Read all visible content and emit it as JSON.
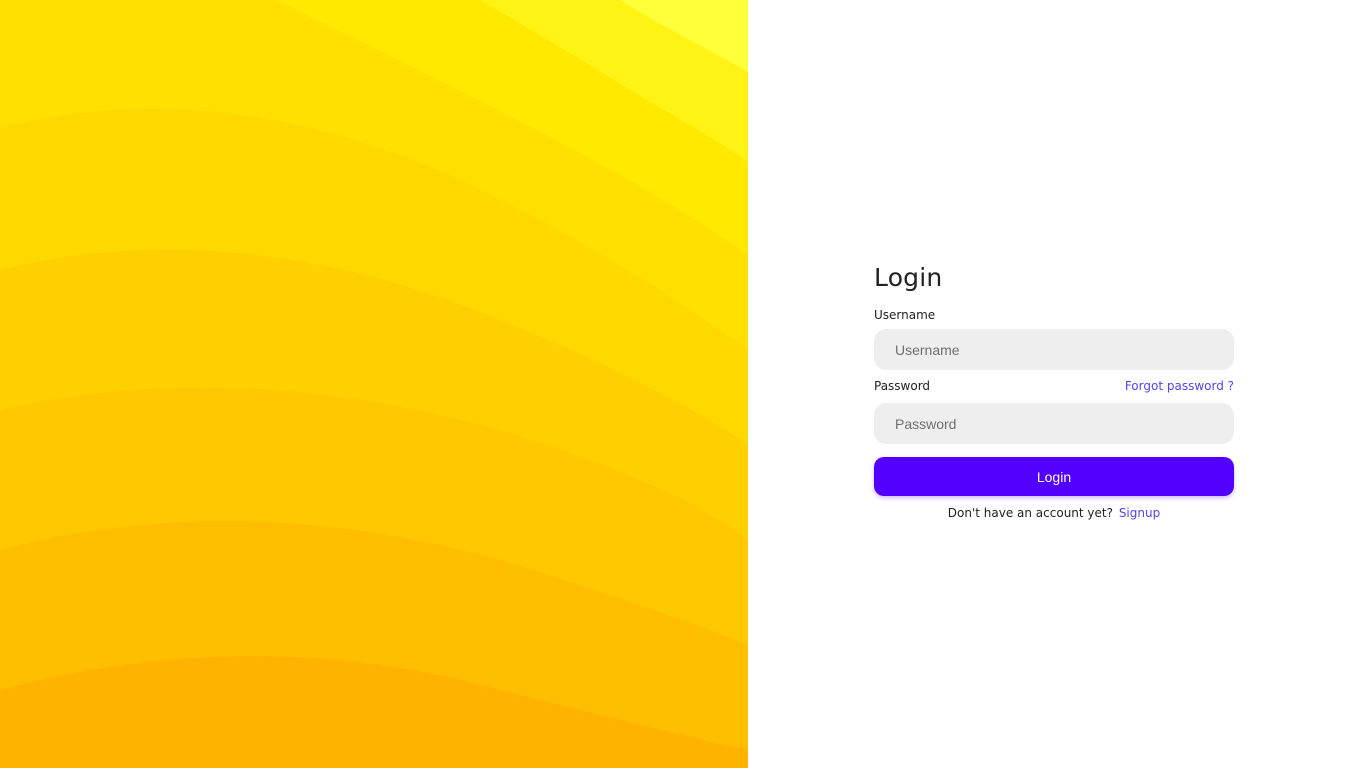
{
  "login": {
    "title": "Login",
    "username_label": "Username",
    "username_placeholder": "Username",
    "username_value": "",
    "password_label": "Password",
    "password_placeholder": "Password",
    "password_value": "",
    "forgot_password_label": "Forgot password ?",
    "submit_label": "Login",
    "signup_prompt": "Don't have an account yet?",
    "signup_label": "Signup"
  },
  "colors": {
    "accent": "#5200ff",
    "link": "#5046e5",
    "input_background": "#eeeeee",
    "hero_light": "#ffff3a",
    "hero_dark": "#ffb300"
  }
}
